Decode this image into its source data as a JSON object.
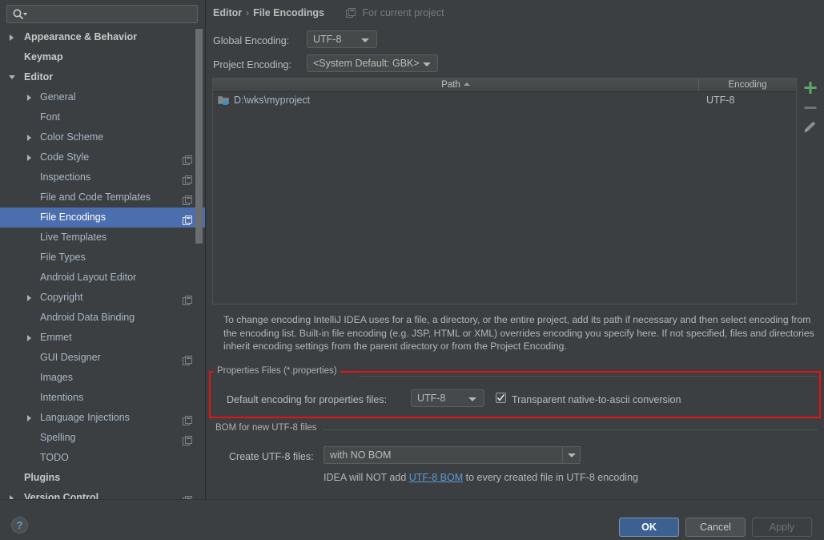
{
  "search": {
    "placeholder": "",
    "value": "",
    "icon": "search-icon"
  },
  "sidebar": {
    "items": [
      {
        "label": "Appearance & Behavior",
        "depth": 0,
        "arrow": "collapsed",
        "bold": true,
        "selected": false,
        "project_icon": false
      },
      {
        "label": "Keymap",
        "depth": 0,
        "arrow": "none",
        "bold": true,
        "selected": false,
        "project_icon": false
      },
      {
        "label": "Editor",
        "depth": 0,
        "arrow": "expanded",
        "bold": true,
        "selected": false,
        "project_icon": false
      },
      {
        "label": "General",
        "depth": 1,
        "arrow": "collapsed",
        "bold": false,
        "selected": false,
        "project_icon": false
      },
      {
        "label": "Font",
        "depth": 1,
        "arrow": "none",
        "bold": false,
        "selected": false,
        "project_icon": false
      },
      {
        "label": "Color Scheme",
        "depth": 1,
        "arrow": "collapsed",
        "bold": false,
        "selected": false,
        "project_icon": false
      },
      {
        "label": "Code Style",
        "depth": 1,
        "arrow": "collapsed",
        "bold": false,
        "selected": false,
        "project_icon": true
      },
      {
        "label": "Inspections",
        "depth": 1,
        "arrow": "none",
        "bold": false,
        "selected": false,
        "project_icon": true
      },
      {
        "label": "File and Code Templates",
        "depth": 1,
        "arrow": "none",
        "bold": false,
        "selected": false,
        "project_icon": true
      },
      {
        "label": "File Encodings",
        "depth": 1,
        "arrow": "none",
        "bold": false,
        "selected": true,
        "project_icon": true
      },
      {
        "label": "Live Templates",
        "depth": 1,
        "arrow": "none",
        "bold": false,
        "selected": false,
        "project_icon": false
      },
      {
        "label": "File Types",
        "depth": 1,
        "arrow": "none",
        "bold": false,
        "selected": false,
        "project_icon": false
      },
      {
        "label": "Android Layout Editor",
        "depth": 1,
        "arrow": "none",
        "bold": false,
        "selected": false,
        "project_icon": false
      },
      {
        "label": "Copyright",
        "depth": 1,
        "arrow": "collapsed",
        "bold": false,
        "selected": false,
        "project_icon": true
      },
      {
        "label": "Android Data Binding",
        "depth": 1,
        "arrow": "none",
        "bold": false,
        "selected": false,
        "project_icon": false
      },
      {
        "label": "Emmet",
        "depth": 1,
        "arrow": "collapsed",
        "bold": false,
        "selected": false,
        "project_icon": false
      },
      {
        "label": "GUI Designer",
        "depth": 1,
        "arrow": "none",
        "bold": false,
        "selected": false,
        "project_icon": true
      },
      {
        "label": "Images",
        "depth": 1,
        "arrow": "none",
        "bold": false,
        "selected": false,
        "project_icon": false
      },
      {
        "label": "Intentions",
        "depth": 1,
        "arrow": "none",
        "bold": false,
        "selected": false,
        "project_icon": false
      },
      {
        "label": "Language Injections",
        "depth": 1,
        "arrow": "collapsed",
        "bold": false,
        "selected": false,
        "project_icon": true
      },
      {
        "label": "Spelling",
        "depth": 1,
        "arrow": "none",
        "bold": false,
        "selected": false,
        "project_icon": true
      },
      {
        "label": "TODO",
        "depth": 1,
        "arrow": "none",
        "bold": false,
        "selected": false,
        "project_icon": false
      },
      {
        "label": "Plugins",
        "depth": 0,
        "arrow": "none",
        "bold": true,
        "selected": false,
        "project_icon": false
      },
      {
        "label": "Version Control",
        "depth": 0,
        "arrow": "collapsed",
        "bold": true,
        "selected": false,
        "project_icon": true
      }
    ]
  },
  "header": {
    "crumb_parent": "Editor",
    "crumb_sep": "›",
    "crumb_current": "File Encodings",
    "for_current_project": "For current project",
    "for_current_project_icon": "module-icon"
  },
  "encodings": {
    "global_label": "Global Encoding:",
    "global_value": "UTF-8",
    "project_label": "Project Encoding:",
    "project_value": "<System Default: GBK>"
  },
  "table": {
    "columns": [
      "Path",
      "Encoding"
    ],
    "sort_column": "Path",
    "sort_direction": "ascending",
    "rows": [
      {
        "path": "D:\\wks\\myproject",
        "encoding": "UTF-8",
        "icon": "folder-module-icon"
      }
    ],
    "toolbar": [
      {
        "name": "add-button",
        "icon": "plus-icon",
        "color": "#59a869",
        "enabled": true
      },
      {
        "name": "remove-button",
        "icon": "minus-icon",
        "color": "#6e7273",
        "enabled": false
      },
      {
        "name": "edit-button",
        "icon": "pencil-icon",
        "color": "#9a9a9a",
        "enabled": true
      }
    ]
  },
  "description": "To change encoding IntelliJ IDEA uses for a file, a directory, or the entire project, add its path if necessary and then select encoding from the encoding list. Built-in file encoding (e.g. JSP, HTML or XML) overrides encoding you specify here. If not specified, files and directories inherit encoding settings from the parent directory or from the Project Encoding.",
  "properties_group": {
    "title": "Properties Files (*.properties)",
    "default_encoding_label": "Default encoding for properties files:",
    "default_encoding_value": "UTF-8",
    "checkbox_label": "Transparent native-to-ascii conversion",
    "checkbox_checked": true,
    "highlight_color": "#e81212"
  },
  "bom_group": {
    "title": "BOM for new UTF-8 files",
    "create_label": "Create UTF-8 files:",
    "create_value": "with NO BOM",
    "note_before": "IDEA will NOT add ",
    "note_link": "UTF-8 BOM",
    "note_after": " to every created file in UTF-8 encoding"
  },
  "footer": {
    "help": "?",
    "ok": "OK",
    "cancel": "Cancel",
    "apply": "Apply"
  },
  "colors": {
    "background": "#3c3f41",
    "selection": "#4b6eaf",
    "ok_button": "#3c6190",
    "link": "#5b9ad6",
    "accent_green": "#59a869"
  }
}
